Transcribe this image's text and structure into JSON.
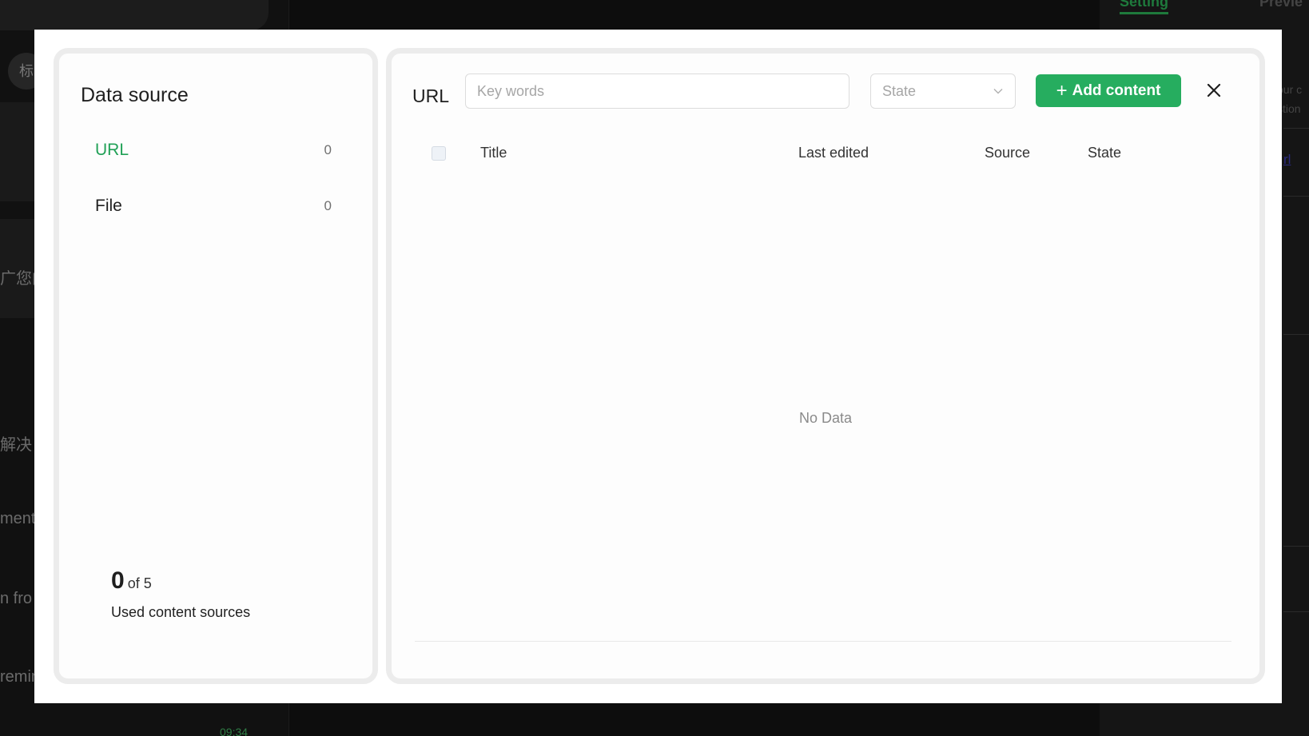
{
  "background": {
    "left_avatar_text": "标",
    "snippets": [
      "广您的",
      "解决",
      "ment",
      "n fro",
      "remin"
    ],
    "time": "09:34",
    "right_tabs": [
      "Setting",
      "Previe"
    ],
    "right_snippets": [
      "our c",
      "stion"
    ],
    "right_link": "rl"
  },
  "sidebar": {
    "title": "Data source",
    "items": [
      {
        "label": "URL",
        "count": "0",
        "active": true
      },
      {
        "label": "File",
        "count": "0",
        "active": false
      }
    ],
    "usage": {
      "used": "0",
      "total_text": "of 5",
      "caption": "Used content sources"
    }
  },
  "main": {
    "title": "URL",
    "search": {
      "placeholder": "Key words",
      "value": ""
    },
    "state_select": {
      "placeholder": "State"
    },
    "add_button_label": "Add content",
    "table": {
      "columns": [
        "Title",
        "Last edited",
        "Source",
        "State"
      ],
      "rows": [],
      "empty_text": "No Data"
    }
  },
  "colors": {
    "accent": "#26ad5f",
    "active_text": "#21a157"
  }
}
